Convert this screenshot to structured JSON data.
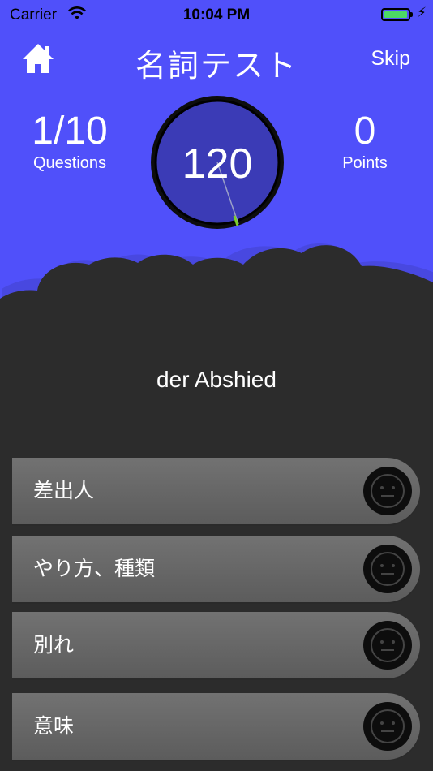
{
  "status_bar": {
    "carrier": "Carrier",
    "time": "10:04 PM"
  },
  "header": {
    "title": "名詞テスト",
    "skip_label": "Skip",
    "home_icon": "home-icon"
  },
  "stats": {
    "questions_value": "1/10",
    "questions_label": "Questions",
    "points_value": "0",
    "points_label": "Points"
  },
  "timer": {
    "value": "120",
    "needle_color": "#7ccf2a",
    "ring_color": "#0d0d0d",
    "face_color": "#3b3bb6"
  },
  "question": {
    "word": "der Abshied"
  },
  "answers": [
    {
      "label": "差出人",
      "icon": "neutral-face-icon"
    },
    {
      "label": "やり方、種類",
      "icon": "neutral-face-icon"
    },
    {
      "label": "別れ",
      "icon": "neutral-face-icon"
    },
    {
      "label": "意味",
      "icon": "neutral-face-icon"
    }
  ],
  "colors": {
    "background": "#5050fa",
    "cloud": "#2c2c2c",
    "answer_bar": "#666666"
  }
}
